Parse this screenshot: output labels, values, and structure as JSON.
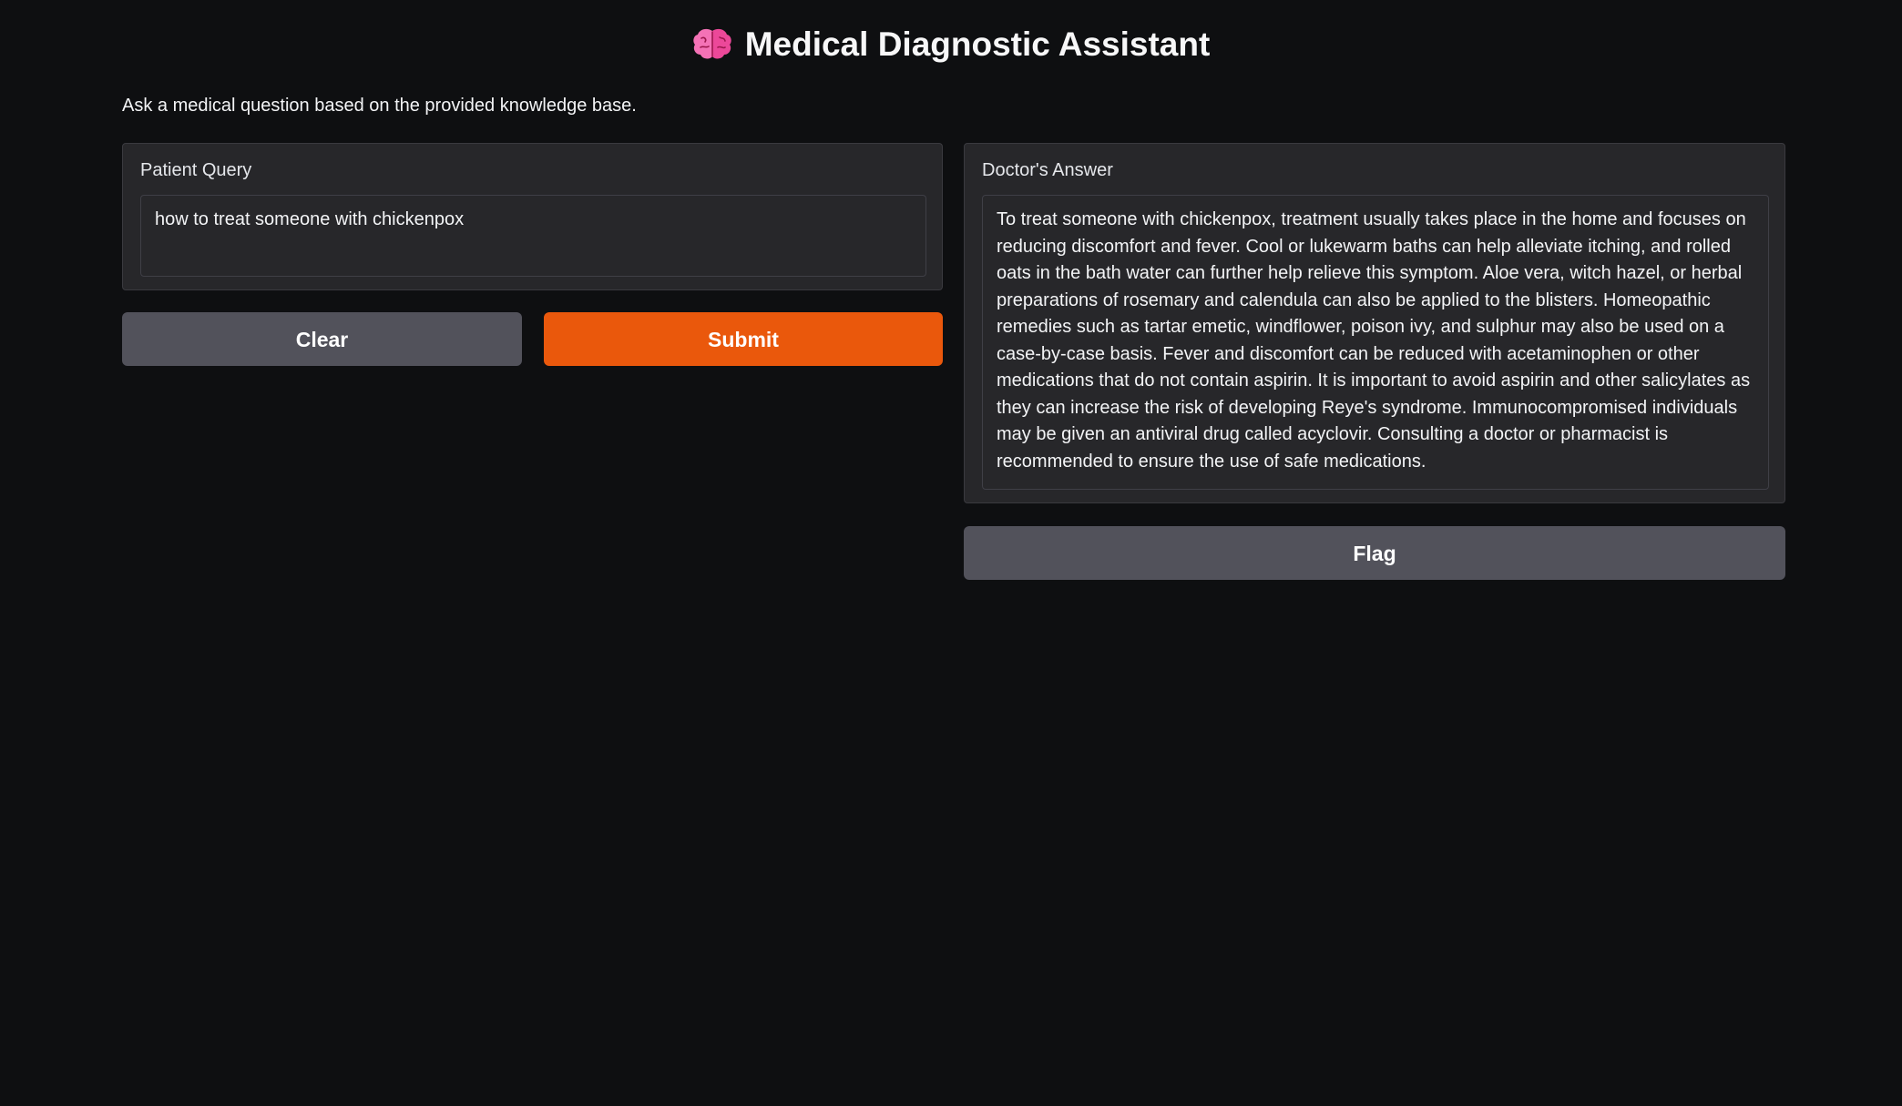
{
  "app": {
    "title": "Medical Diagnostic Assistant",
    "title_icon": "brain-icon",
    "description": "Ask a medical question based on the provided knowledge base."
  },
  "query": {
    "label": "Patient Query",
    "value": "how to treat someone with chickenpox"
  },
  "answer": {
    "label": "Doctor's Answer",
    "text": "To treat someone with chickenpox, treatment usually takes place in the home and focuses on reducing discomfort and fever. Cool or lukewarm baths can help alleviate itching, and rolled oats in the bath water can further help relieve this symptom. Aloe vera, witch hazel, or herbal preparations of rosemary and calendula can also be applied to the blisters. Homeopathic remedies such as tartar emetic, windflower, poison ivy, and sulphur may also be used on a case-by-case basis. Fever and discomfort can be reduced with acetaminophen or other medications that do not contain aspirin. It is important to avoid aspirin and other salicylates as they can increase the risk of developing Reye's syndrome. Immunocompromised individuals may be given an antiviral drug called acyclovir. Consulting a doctor or pharmacist is recommended to ensure the use of safe medications."
  },
  "buttons": {
    "clear_label": "Clear",
    "submit_label": "Submit",
    "flag_label": "Flag"
  },
  "colors": {
    "background": "#0e0f11",
    "panel": "#27272a",
    "primary_button": "#ea580c",
    "secondary_button": "#52525b"
  }
}
